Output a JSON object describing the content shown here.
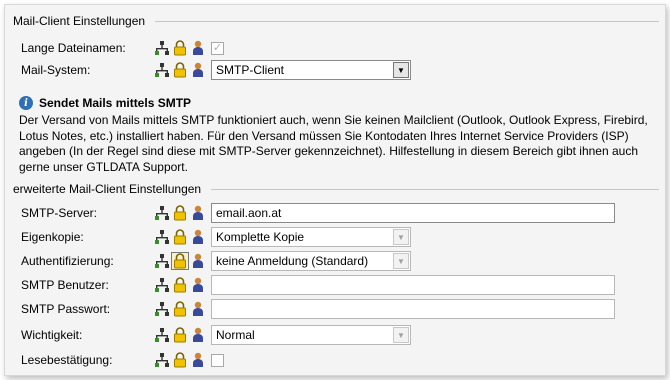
{
  "section_mail_client": {
    "title": "Mail-Client Einstellungen",
    "long_filenames_label": "Lange Dateinamen:",
    "mail_system_label": "Mail-System:",
    "mail_system_value": "SMTP-Client"
  },
  "info": {
    "title": "Sendet Mails mittels SMTP",
    "text": "Der Versand von Mails mittels SMTP funktioniert auch, wenn Sie keinen Mailclient (Outlook, Outlook Express, Firebird, Lotus Notes, etc.) installiert haben. Für den Versand müssen Sie Kontodaten Ihres Internet Service Providers (ISP) angeben (In der Regel sind diese mit SMTP-Server gekennzeichnet). Hilfestellung in diesem Bereich gibt ihnen auch gerne unser GTLDATA Support."
  },
  "section_extended": {
    "title": "erweiterte Mail-Client Einstellungen",
    "smtp_server_label": "SMTP-Server:",
    "smtp_server_value": "email.aon.at",
    "copy_label": "Eigenkopie:",
    "copy_value": "Komplette Kopie",
    "auth_label": "Authentifizierung:",
    "auth_value": "keine Anmeldung (Standard)",
    "user_label": "SMTP Benutzer:",
    "user_value": "",
    "password_label": "SMTP Passwort:",
    "password_value": "",
    "priority_label": "Wichtigkeit:",
    "priority_value": "Normal",
    "read_receipt_label": "Lesebestätigung:"
  },
  "icons": {
    "network": "network-icon",
    "lock": "lock-icon",
    "user": "user-icon"
  },
  "colors": {
    "panel_bg": "#f4f4f4",
    "lock_yellow": "#f2c200",
    "info_blue": "#2f6fb5"
  }
}
